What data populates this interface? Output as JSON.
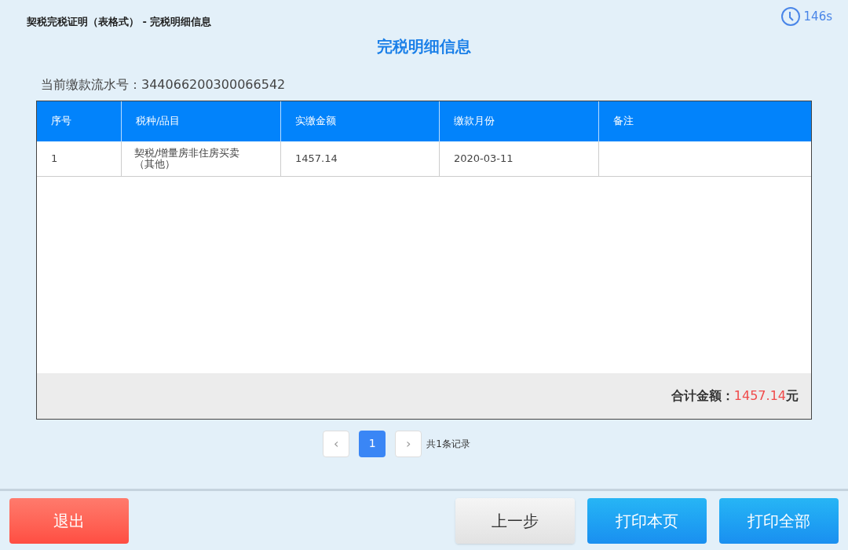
{
  "breadcrumb": "契税完税证明（表格式） - 完税明细信息",
  "timer": "146s",
  "title": "完税明细信息",
  "serial": {
    "label": "当前缴款流水号：",
    "value": "344066200300066542"
  },
  "table": {
    "columns": [
      "序号",
      "税种/品目",
      "实缴金额",
      "缴款月份",
      "备注"
    ],
    "rows": [
      [
        "1",
        "契税/增量房非住房买卖（其他）",
        "1457.14",
        "2020-03-11"
      ]
    ]
  },
  "total": {
    "label": "合计金额：",
    "amount": "1457.14",
    "unit": "元"
  },
  "pagination": {
    "prev": "‹",
    "pages": [
      {
        "label": "1",
        "selected": true
      }
    ],
    "next": "›",
    "summary": "共1条记录"
  },
  "buttons": [
    {
      "label": "退出",
      "kind": "danger"
    },
    {
      "label": "上一步",
      "kind": "default"
    },
    {
      "label": "打印本页",
      "kind": "primary"
    },
    {
      "label": "打印全部",
      "kind": "primary"
    }
  ]
}
